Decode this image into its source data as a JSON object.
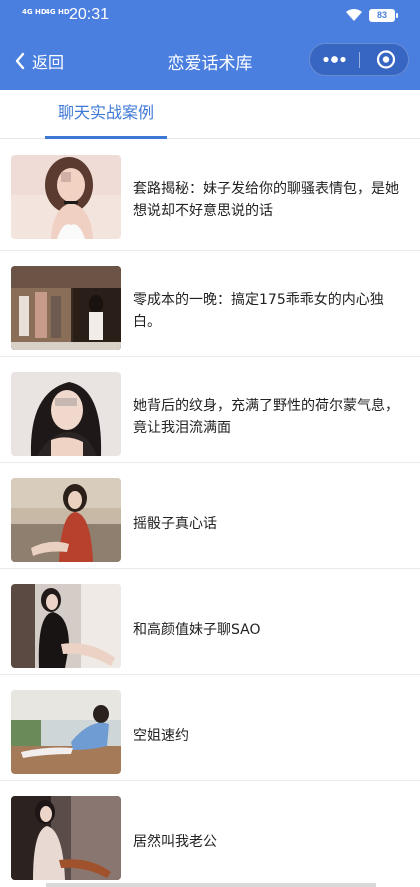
{
  "status_bar": {
    "signal_1": "4G HD",
    "signal_2": "4G HD",
    "time": "20:31",
    "battery": "83"
  },
  "nav": {
    "back_label": "返回",
    "title": "恋爱话术库"
  },
  "tabs": [
    {
      "label": "聊天实战案例",
      "active": true
    }
  ],
  "articles": [
    {
      "title": "套路揭秘：妹子发给你的聊骚表情包，是她想说却不好意思说的话",
      "thumbnail": "photo-woman-choker"
    },
    {
      "title": "零成本的一晚：搞定175乖乖女的内心独白。",
      "thumbnail": "photo-mall-women"
    },
    {
      "title": "她背后的纹身，充满了野性的荷尔蒙气息，竟让我泪流满面",
      "thumbnail": "photo-woman-longhair"
    },
    {
      "title": "摇骰子真心话",
      "thumbnail": "photo-woman-red-dress"
    },
    {
      "title": "和高颜值妹子聊SAO",
      "thumbnail": "photo-woman-black"
    },
    {
      "title": "空姐速约",
      "thumbnail": "photo-woman-blue-dress"
    },
    {
      "title": "居然叫我老公",
      "thumbnail": "photo-woman-dark-room"
    }
  ],
  "colors": {
    "header": "#4a7fe0",
    "tab_active": "#3e78d6"
  }
}
